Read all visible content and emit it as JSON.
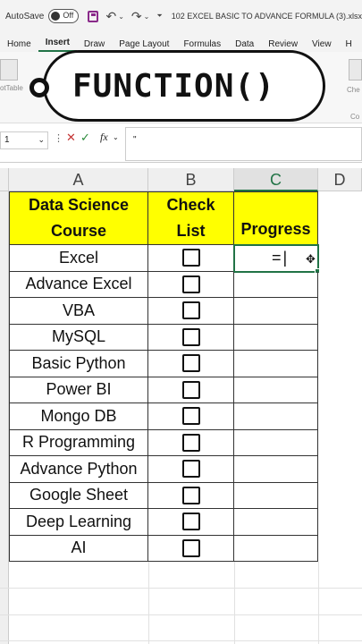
{
  "titlebar": {
    "autosave_label": "AutoSave",
    "autosave_state": "Off",
    "filename": "102 EXCEL BASIC TO ADVANCE FORMULA (3).xlsx"
  },
  "ribbon": {
    "tabs": [
      "Home",
      "Insert",
      "Draw",
      "Page Layout",
      "Formulas",
      "Data",
      "Review",
      "View",
      "H"
    ],
    "active_tab": "Insert",
    "ghost_left": "otTable",
    "ghost_right": "Che",
    "ghost_right2": "Co"
  },
  "banner": {
    "text": "FUNCTION()"
  },
  "formula_bar": {
    "name_box": "1",
    "fx_label": "fx",
    "content": "\""
  },
  "columns": {
    "A": "A",
    "B": "B",
    "C": "C",
    "D": "D"
  },
  "table": {
    "header": {
      "a_line1": "Data Science",
      "a_line2": "Course",
      "b_line1": "Check",
      "b_line2": "List",
      "c_line2": "Progress"
    },
    "rows": [
      {
        "course": "Excel",
        "progress": "="
      },
      {
        "course": "Advance Excel",
        "progress": ""
      },
      {
        "course": "VBA",
        "progress": ""
      },
      {
        "course": "MySQL",
        "progress": ""
      },
      {
        "course": "Basic Python",
        "progress": ""
      },
      {
        "course": "Power BI",
        "progress": ""
      },
      {
        "course": "Mongo DB",
        "progress": ""
      },
      {
        "course": "R Programming",
        "progress": ""
      },
      {
        "course": "Advance Python",
        "progress": ""
      },
      {
        "course": "Google Sheet",
        "progress": ""
      },
      {
        "course": "Deep Learning",
        "progress": ""
      },
      {
        "course": "AI",
        "progress": ""
      }
    ]
  },
  "colors": {
    "header_fill": "#ffff00",
    "excel_green": "#217346"
  }
}
